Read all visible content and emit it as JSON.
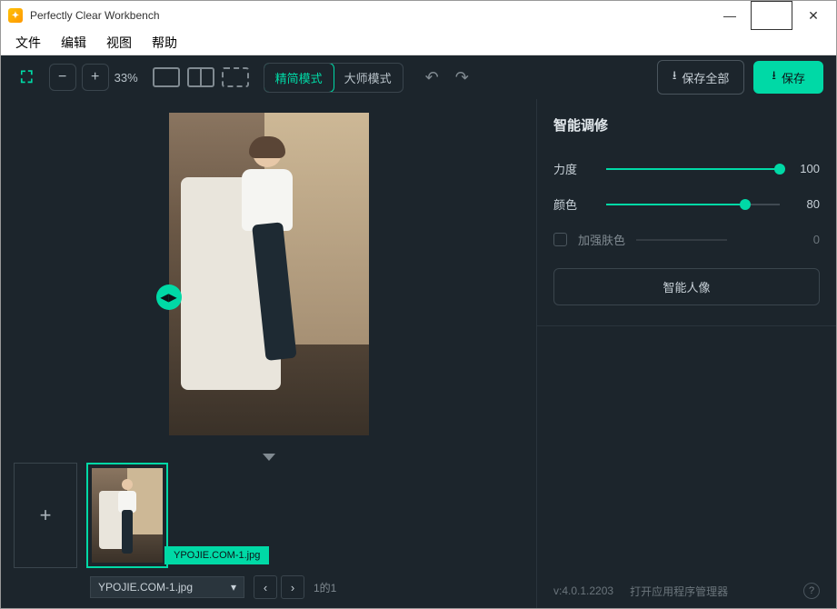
{
  "title": "Perfectly Clear Workbench",
  "menu": {
    "file": "文件",
    "edit": "编辑",
    "view": "视图",
    "help": "帮助"
  },
  "toolbar": {
    "zoom_level": "33%",
    "mode_simple": "精简模式",
    "mode_master": "大师模式",
    "save_all": "保存全部",
    "save": "保存"
  },
  "filmstrip": {
    "thumb_name": "YPOJIE.COM-1.jpg",
    "filename": "YPOJIE.COM-1.jpg",
    "page": "1的1"
  },
  "panel": {
    "title": "智能调修",
    "strength_label": "力度",
    "strength_value": "100",
    "color_label": "颜色",
    "color_value": "80",
    "skin_label": "加强肤色",
    "skin_value": "0",
    "portrait_btn": "智能人像"
  },
  "footer": {
    "version": "v:4.0.1.2203",
    "manager": "打开应用程序管理器"
  }
}
